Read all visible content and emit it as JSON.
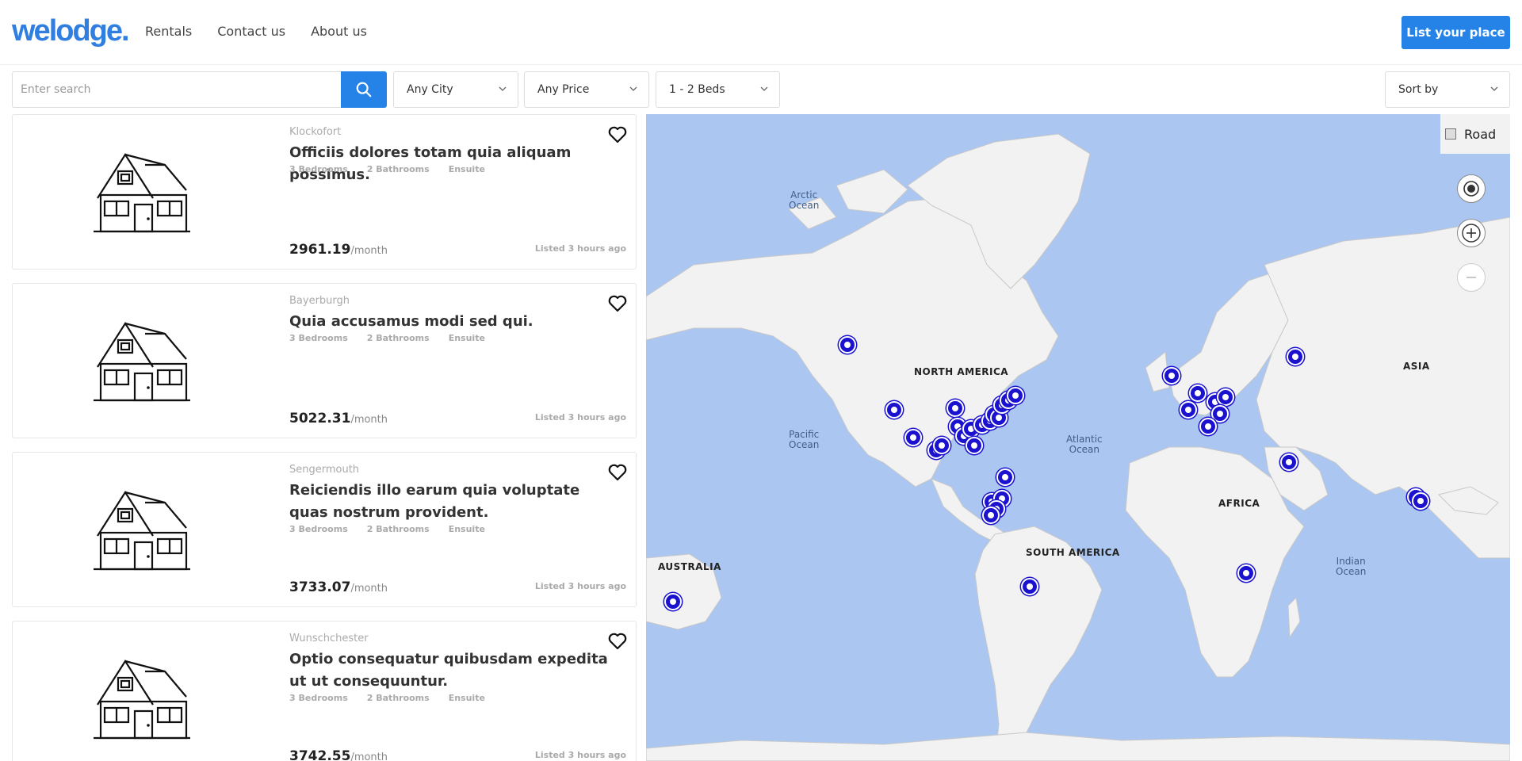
{
  "header": {
    "logo": "welodge",
    "nav": [
      "Rentals",
      "Contact us",
      "About us"
    ],
    "cta": "List your place"
  },
  "filters": {
    "search_placeholder": "Enter search",
    "city": "Any City",
    "price": "Any Price",
    "beds": "1 - 2 Beds",
    "sort": "Sort by"
  },
  "listings": [
    {
      "city": "Klockofort",
      "title": "Officiis dolores totam quia aliquam possimus.",
      "bedrooms": "3 Bedrooms",
      "bathrooms": "2 Bathrooms",
      "ensuite": "Ensuite",
      "price": "2961.19",
      "per": "/month",
      "listed": "Listed 3 hours ago"
    },
    {
      "city": "Bayerburgh",
      "title": "Quia accusamus modi sed qui.",
      "bedrooms": "3 Bedrooms",
      "bathrooms": "2 Bathrooms",
      "ensuite": "Ensuite",
      "price": "5022.31",
      "per": "/month",
      "listed": "Listed 3 hours ago"
    },
    {
      "city": "Sengermouth",
      "title": "Reiciendis illo earum quia voluptate quas nostrum provident.",
      "bedrooms": "3 Bedrooms",
      "bathrooms": "2 Bathrooms",
      "ensuite": "Ensuite",
      "price": "3733.07",
      "per": "/month",
      "listed": "Listed 3 hours ago"
    },
    {
      "city": "Wunschchester",
      "title": "Optio consequatur quibusdam expedita ut ut consequuntur.",
      "bedrooms": "3 Bedrooms",
      "bathrooms": "2 Bathrooms",
      "ensuite": "Ensuite",
      "price": "3742.55",
      "per": "/month",
      "listed": "Listed 3 hours ago"
    }
  ],
  "map": {
    "road_label": "Road",
    "continents": [
      "NORTH AMERICA",
      "SOUTH AMERICA",
      "AFRICA",
      "ASIA",
      "AUSTRALIA"
    ],
    "oceans": [
      "Arctic\nOcean",
      "Pacific\nOcean",
      "Atlantic\nOcean",
      "Indian\nOcean"
    ],
    "controls": [
      "locate-icon",
      "zoom-in-icon",
      "zoom-out-icon"
    ]
  },
  "colors": {
    "brand": "#2582e6",
    "marker": "#1a12cf",
    "water": "#aac6f1",
    "land": "#f2f2f2"
  }
}
